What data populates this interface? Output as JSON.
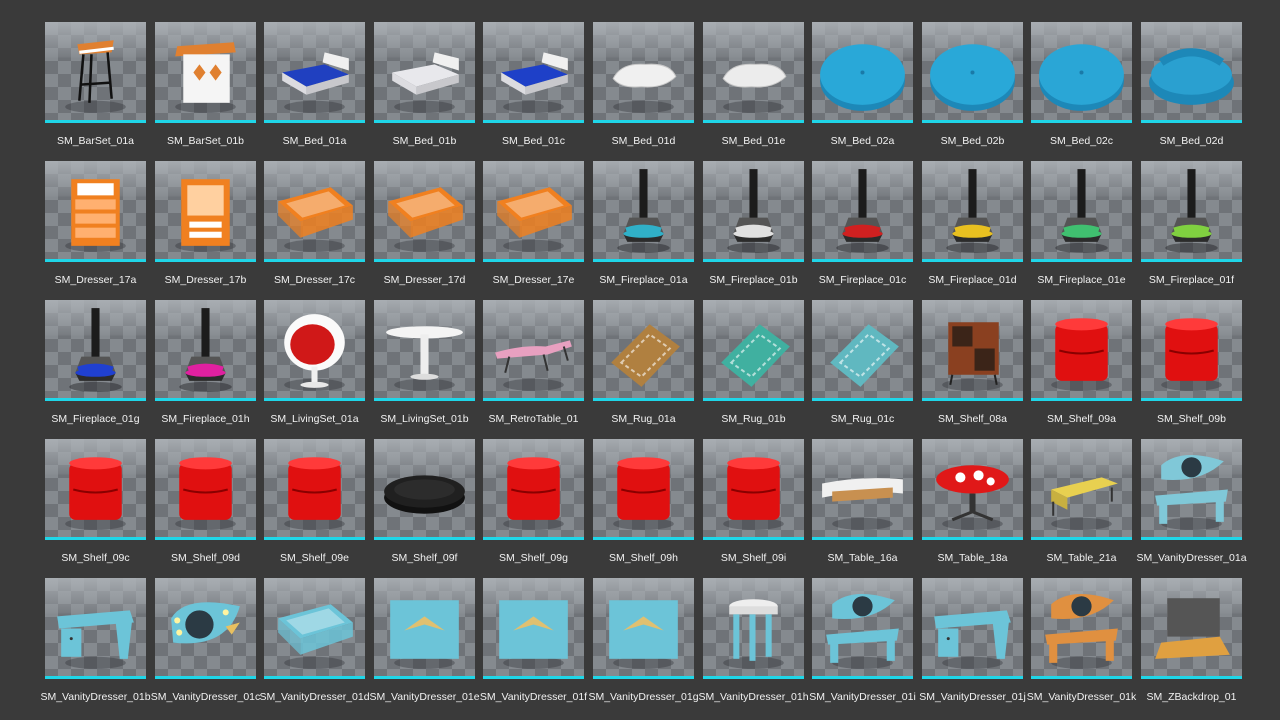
{
  "browser": {
    "assets": [
      {
        "name": "SM_BarSet_01a",
        "icon": "bar-stool-icon",
        "color": "#e08030"
      },
      {
        "name": "SM_BarSet_01b",
        "icon": "bar-counter-icon",
        "color": "#e08030"
      },
      {
        "name": "SM_Bed_01a",
        "icon": "bed-icon",
        "color": "#2040c0"
      },
      {
        "name": "SM_Bed_01b",
        "icon": "bed-icon",
        "color": "#e8e8ec"
      },
      {
        "name": "SM_Bed_01c",
        "icon": "bed-icon",
        "color": "#1e40c8"
      },
      {
        "name": "SM_Bed_01d",
        "icon": "pillow-icon",
        "color": "#f0f0f0"
      },
      {
        "name": "SM_Bed_01e",
        "icon": "pillow-icon",
        "color": "#ececec"
      },
      {
        "name": "SM_Bed_02a",
        "icon": "round-cushion-icon",
        "color": "#29a8d8"
      },
      {
        "name": "SM_Bed_02b",
        "icon": "round-cushion-icon",
        "color": "#29a8d8"
      },
      {
        "name": "SM_Bed_02c",
        "icon": "round-cushion-icon",
        "color": "#2aa6d6"
      },
      {
        "name": "SM_Bed_02d",
        "icon": "round-bed-icon",
        "color": "#2aa0d0"
      },
      {
        "name": "SM_Dresser_17a",
        "icon": "dresser-icon",
        "color": "#f08020"
      },
      {
        "name": "SM_Dresser_17b",
        "icon": "open-dresser-icon",
        "color": "#f08020"
      },
      {
        "name": "SM_Dresser_17c",
        "icon": "drawer-icon",
        "color": "#f08020"
      },
      {
        "name": "SM_Dresser_17d",
        "icon": "drawer-icon",
        "color": "#f08020"
      },
      {
        "name": "SM_Dresser_17e",
        "icon": "drawer-icon",
        "color": "#f08020"
      },
      {
        "name": "SM_Fireplace_01a",
        "icon": "fireplace-icon",
        "color": "#30b0c8"
      },
      {
        "name": "SM_Fireplace_01b",
        "icon": "fireplace-icon",
        "color": "#e0e0e0"
      },
      {
        "name": "SM_Fireplace_01c",
        "icon": "fireplace-icon",
        "color": "#d02020"
      },
      {
        "name": "SM_Fireplace_01d",
        "icon": "fireplace-icon",
        "color": "#e8c020"
      },
      {
        "name": "SM_Fireplace_01e",
        "icon": "fireplace-icon",
        "color": "#40c070"
      },
      {
        "name": "SM_Fireplace_01f",
        "icon": "fireplace-icon",
        "color": "#80d040"
      },
      {
        "name": "SM_Fireplace_01g",
        "icon": "fireplace-icon",
        "color": "#2040d0"
      },
      {
        "name": "SM_Fireplace_01h",
        "icon": "fireplace-icon",
        "color": "#e020a0"
      },
      {
        "name": "SM_LivingSet_01a",
        "icon": "egg-chair-icon",
        "color": "#d01818"
      },
      {
        "name": "SM_LivingSet_01b",
        "icon": "round-table-icon",
        "color": "#f4f4f4"
      },
      {
        "name": "SM_RetroTable_01",
        "icon": "retro-table-icon",
        "color": "#e8a0c0"
      },
      {
        "name": "SM_Rug_01a",
        "icon": "rug-icon",
        "color": "#b08040"
      },
      {
        "name": "SM_Rug_01b",
        "icon": "rug-icon",
        "color": "#40b0a0"
      },
      {
        "name": "SM_Rug_01c",
        "icon": "rug-icon",
        "color": "#60b8c0"
      },
      {
        "name": "SM_Shelf_08a",
        "icon": "shelf-icon",
        "color": "#8a4020"
      },
      {
        "name": "SM_Shelf_09a",
        "icon": "round-shelf-icon",
        "color": "#e01010"
      },
      {
        "name": "SM_Shelf_09b",
        "icon": "round-shelf-icon",
        "color": "#e01010"
      },
      {
        "name": "SM_Shelf_09c",
        "icon": "round-shelf-icon",
        "color": "#e01010"
      },
      {
        "name": "SM_Shelf_09d",
        "icon": "round-shelf-icon",
        "color": "#e01010"
      },
      {
        "name": "SM_Shelf_09e",
        "icon": "round-shelf-icon",
        "color": "#e01010"
      },
      {
        "name": "SM_Shelf_09f",
        "icon": "round-lid-icon",
        "color": "#202020"
      },
      {
        "name": "SM_Shelf_09g",
        "icon": "round-shelf-icon",
        "color": "#e01010"
      },
      {
        "name": "SM_Shelf_09h",
        "icon": "round-shelf-icon",
        "color": "#e01010"
      },
      {
        "name": "SM_Shelf_09i",
        "icon": "round-shelf-icon",
        "color": "#e01010"
      },
      {
        "name": "SM_Table_16a",
        "icon": "coffee-table-icon",
        "color": "#c89050"
      },
      {
        "name": "SM_Table_18a",
        "icon": "round-swivel-table-icon",
        "color": "#e01818"
      },
      {
        "name": "SM_Table_21a",
        "icon": "side-table-icon",
        "color": "#e8d050"
      },
      {
        "name": "SM_VanityDresser_01a",
        "icon": "vanity-dresser-icon",
        "color": "#80c8d8"
      },
      {
        "name": "SM_VanityDresser_01b",
        "icon": "vanity-desk-icon",
        "color": "#6cc4d8"
      },
      {
        "name": "SM_VanityDresser_01c",
        "icon": "vanity-mirror-icon",
        "color": "#6cc4d8"
      },
      {
        "name": "SM_VanityDresser_01d",
        "icon": "drawer-icon",
        "color": "#6cc4d8"
      },
      {
        "name": "SM_VanityDresser_01e",
        "icon": "drawer-front-icon",
        "color": "#6cc4d8"
      },
      {
        "name": "SM_VanityDresser_01f",
        "icon": "drawer-front-icon",
        "color": "#6cc4d8"
      },
      {
        "name": "SM_VanityDresser_01g",
        "icon": "drawer-front-icon",
        "color": "#6cc4d8"
      },
      {
        "name": "SM_VanityDresser_01h",
        "icon": "stool-icon",
        "color": "#6cc4d8"
      },
      {
        "name": "SM_VanityDresser_01i",
        "icon": "vanity-dresser-icon",
        "color": "#6cc4d8"
      },
      {
        "name": "SM_VanityDresser_01j",
        "icon": "vanity-desk-icon",
        "color": "#6cc4d8"
      },
      {
        "name": "SM_VanityDresser_01k",
        "icon": "vanity-dresser-icon",
        "color": "#e09040"
      },
      {
        "name": "SM_ZBackdrop_01",
        "icon": "backdrop-icon",
        "color": "#e0a040"
      }
    ]
  }
}
